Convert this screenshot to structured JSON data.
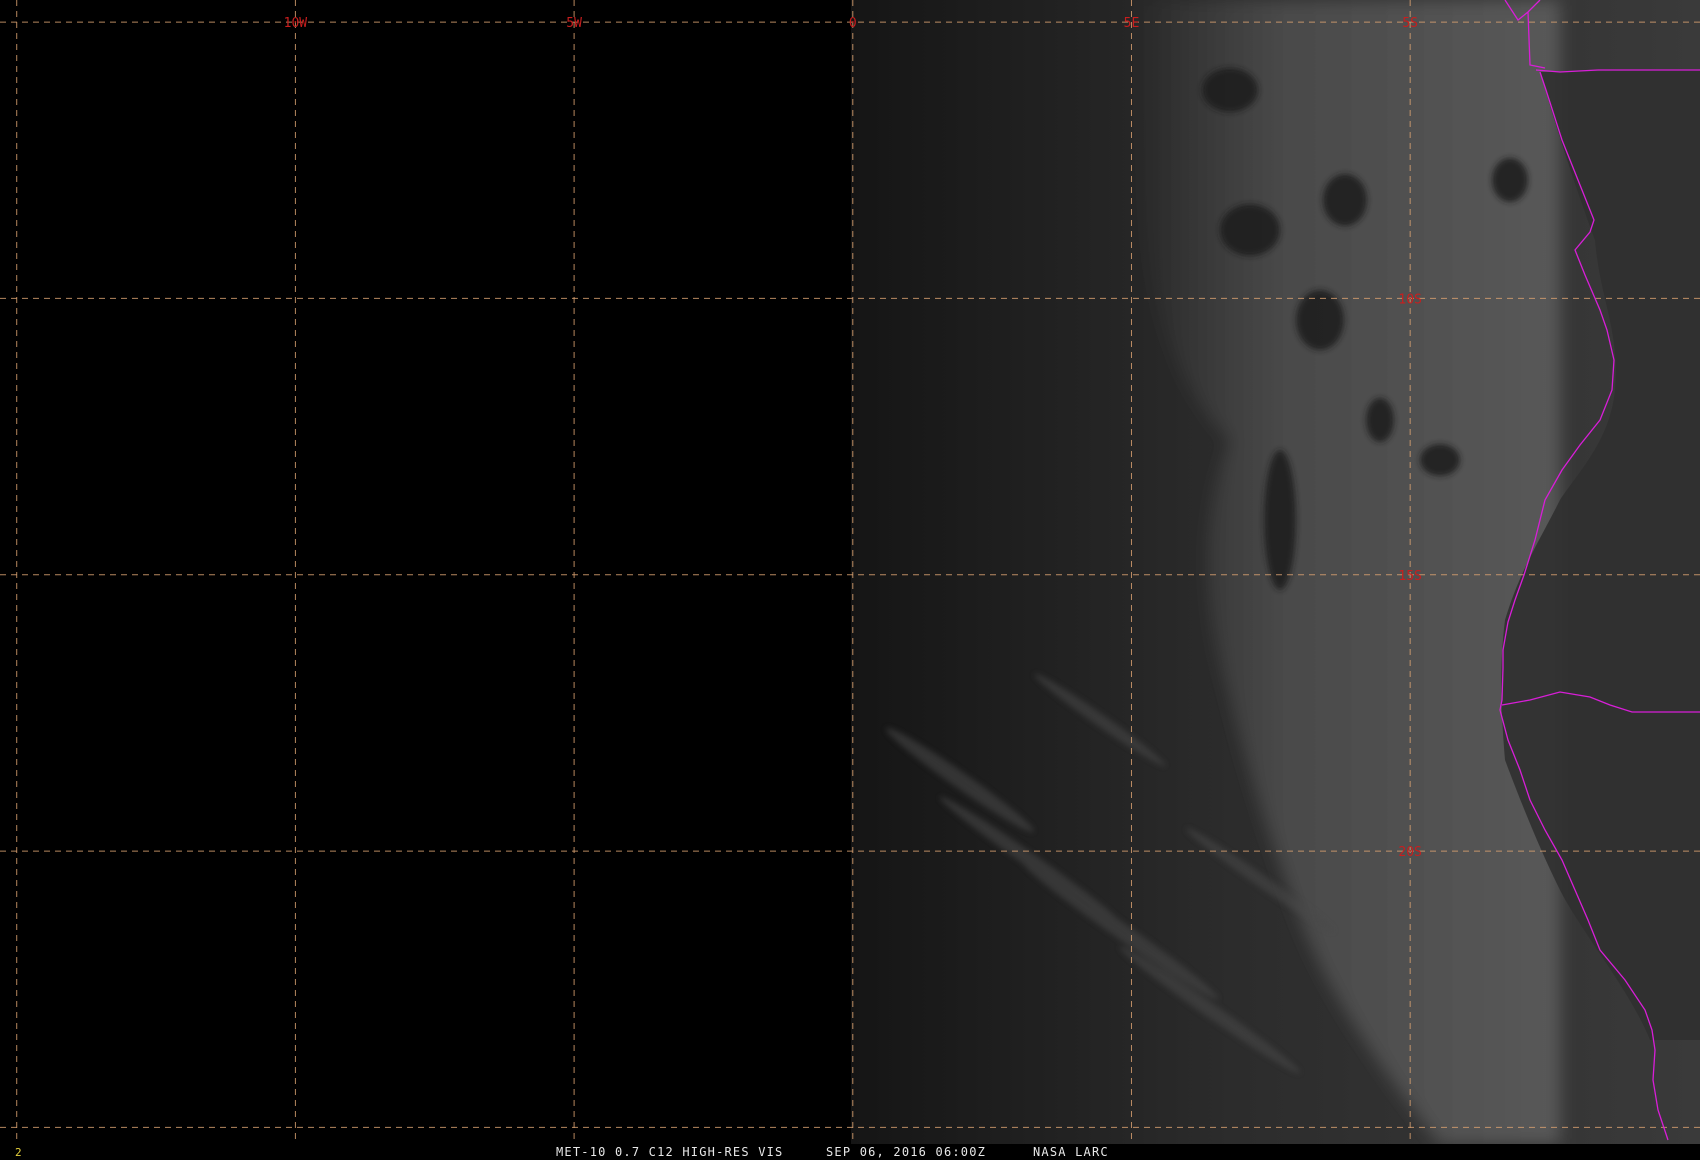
{
  "image": {
    "title": "MET-10 0.7 C12 HIGH-RES VIS",
    "datetime": "SEP 06, 2016 06:00Z",
    "source": "NASA LARC",
    "frame_number": "2"
  },
  "grid": {
    "longitudes": [
      {
        "value": -15,
        "label": ""
      },
      {
        "value": -10,
        "label": "10W"
      },
      {
        "value": -5,
        "label": "5W"
      },
      {
        "value": 0,
        "label": "0"
      },
      {
        "value": 5,
        "label": "5E"
      },
      {
        "value": 10,
        "label": ""
      }
    ],
    "latitudes": [
      {
        "value": -5,
        "label": "5S"
      },
      {
        "value": -10,
        "label": "10S"
      },
      {
        "value": -15,
        "label": "15S"
      },
      {
        "value": -20,
        "label": "20S"
      },
      {
        "value": -25,
        "label": ""
      }
    ],
    "line_color": "#d8a070",
    "label_color": "#c81e1e"
  },
  "map": {
    "lon_range": [
      -15.3,
      15.2
    ],
    "lat_range": [
      -25.3,
      -4.6
    ],
    "coastline_color": "#d81ed8",
    "background_color": "#000000"
  }
}
